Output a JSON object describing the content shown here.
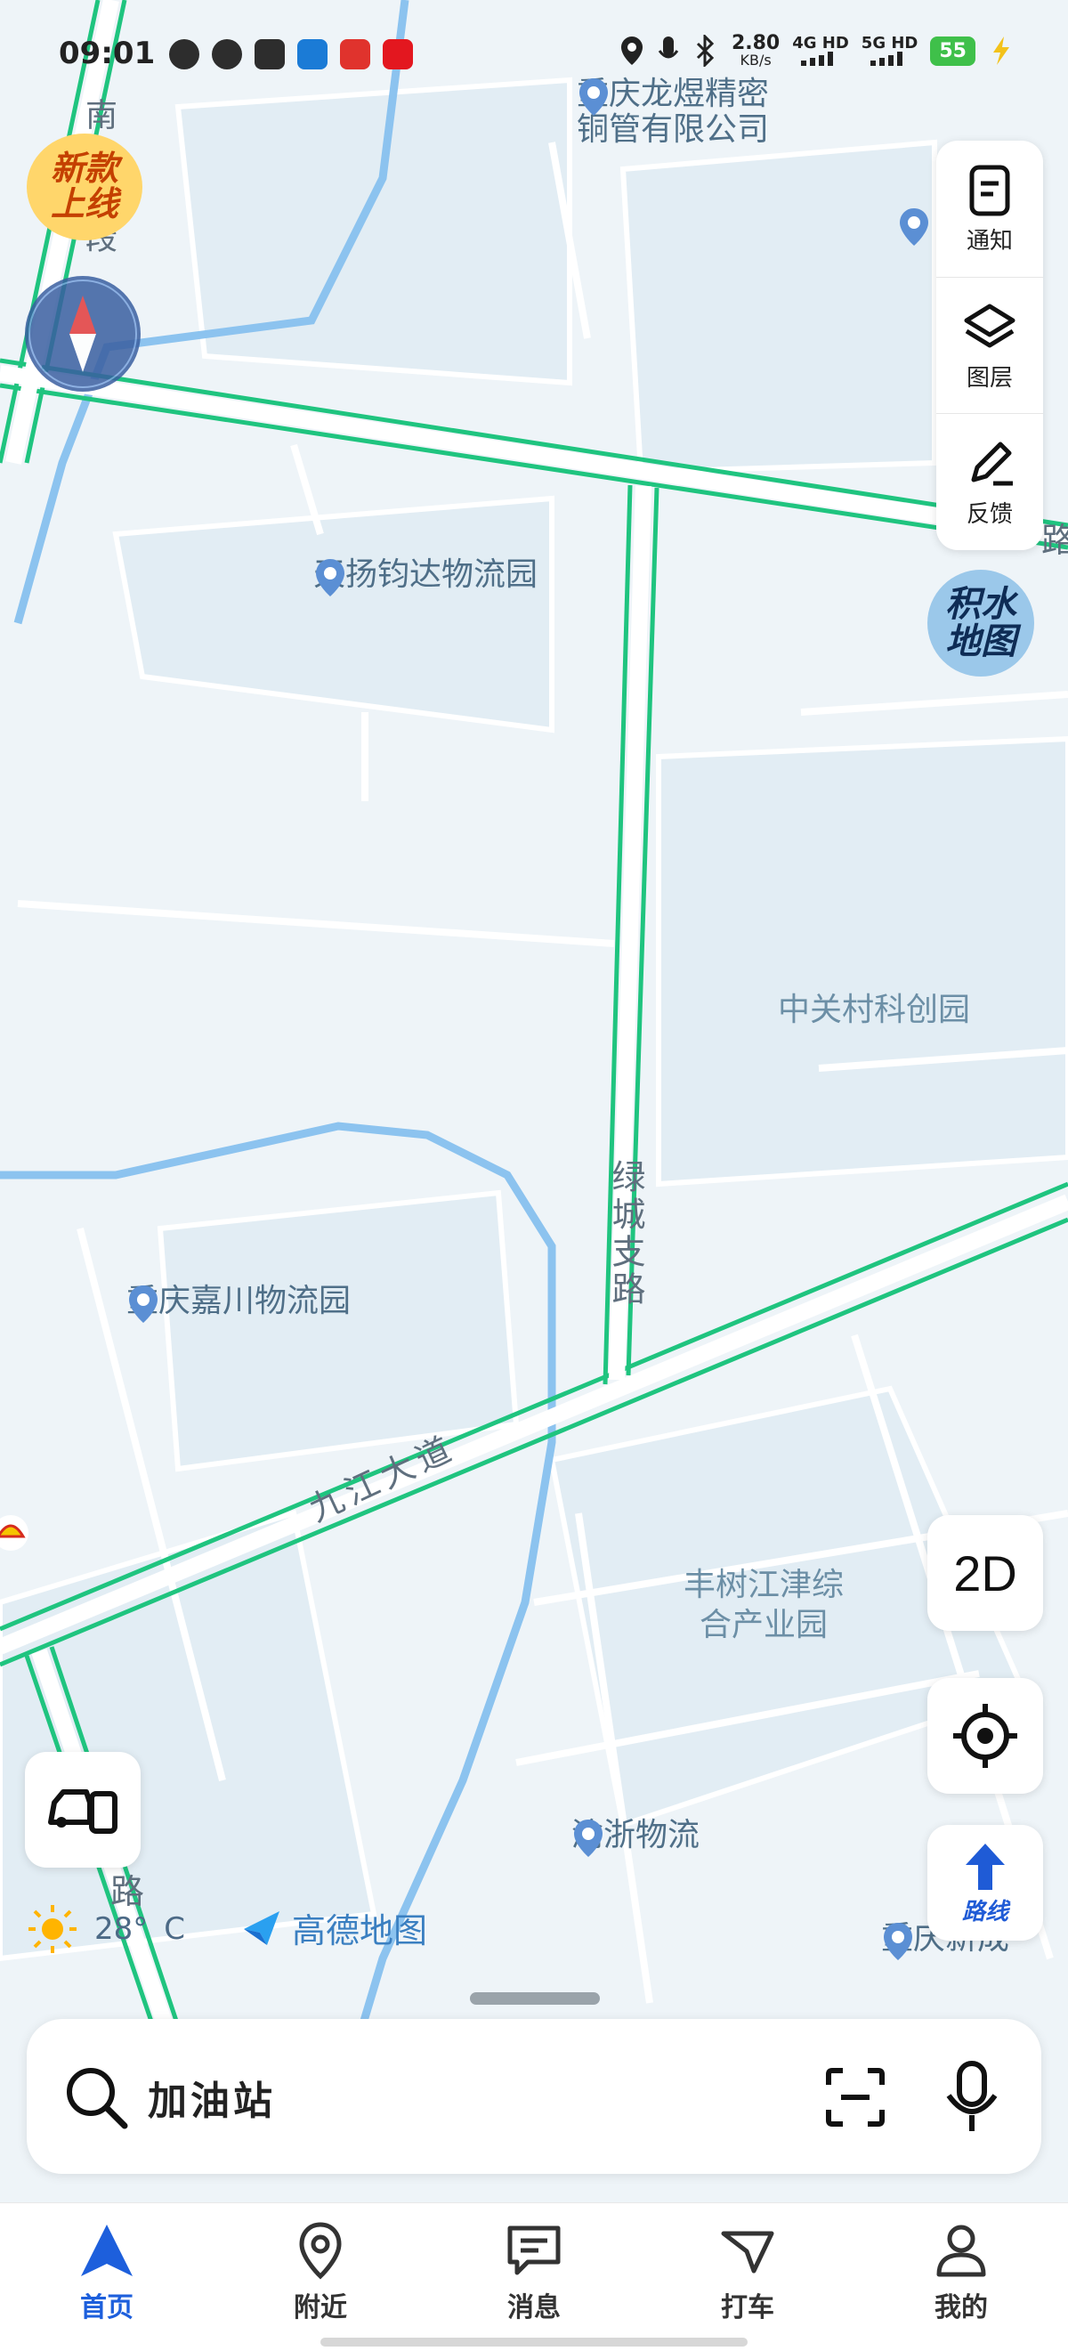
{
  "status_bar": {
    "time": "09:01",
    "net_speed": "2.80",
    "net_unit": "KB/s",
    "sim1": "4G HD",
    "sim2": "5G HD",
    "battery": "55"
  },
  "map": {
    "promo_badge": [
      "新款",
      "上线"
    ],
    "water_badge": [
      "积水",
      "地图"
    ],
    "pois": [
      {
        "name": "重庆龙煜精密\n铜管有限公司"
      },
      {
        "name": "天扬钧达物流园"
      },
      {
        "name": "重庆嘉川物流园"
      },
      {
        "name": "渝浙物流"
      },
      {
        "name": "重庆新成"
      }
    ],
    "areas": {
      "zhongguancun": "中关村科创园",
      "fengshu": "丰树江津综\n合产业园"
    },
    "roads": {
      "jiujiang": "九江大道",
      "lvcheng": "绿城支路",
      "nandao": "南道北段",
      "lu_right": "路",
      "lu_bottom": "路"
    },
    "colors": {
      "road_green": "#1fc47f",
      "river": "#8cc3ef",
      "block": "#e2edf4"
    }
  },
  "side_panel": {
    "items": [
      {
        "label": "通知",
        "icon": "notice-icon"
      },
      {
        "label": "图层",
        "icon": "layers-icon"
      },
      {
        "label": "反馈",
        "icon": "feedback-icon"
      }
    ]
  },
  "controls": {
    "mode_2d": "2D",
    "route_label": "路线"
  },
  "weather": {
    "temp": "28°",
    "unit": "C"
  },
  "brand": "高德地图",
  "search": {
    "text": "加油站"
  },
  "tabs": [
    {
      "label": "首页",
      "icon": "navigation-arrow-icon",
      "active": true
    },
    {
      "label": "附近",
      "icon": "location-pin-icon",
      "active": false
    },
    {
      "label": "消息",
      "icon": "message-icon",
      "active": false
    },
    {
      "label": "打车",
      "icon": "taxi-icon",
      "active": false
    },
    {
      "label": "我的",
      "icon": "profile-icon",
      "active": false
    }
  ]
}
